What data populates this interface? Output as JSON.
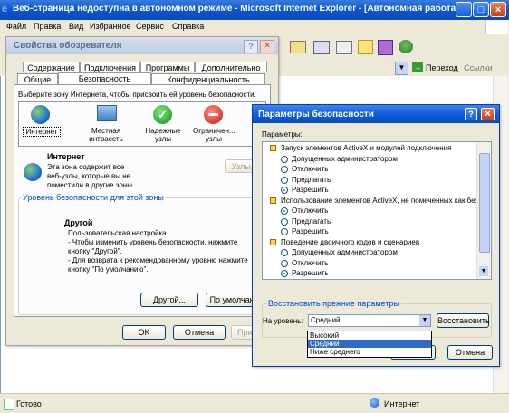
{
  "ie": {
    "title": "Веб-страница недоступна в автономном режиме - Microsoft Internet Explorer - [Автономная работа]",
    "menu": [
      "Файл",
      "Правка",
      "Вид",
      "Избранное",
      "Сервис",
      "Справка"
    ],
    "go_label": "Переход",
    "links_label": "Ссылки",
    "status_left": "Готово",
    "status_zone": "Интернет"
  },
  "props": {
    "title": "Свойства обозревателя",
    "tabs_row1": [
      "Содержание",
      "Подключения",
      "Программы",
      "Дополнительно"
    ],
    "tabs_row2": [
      "Общие",
      "Безопасность",
      "Конфиденциальность"
    ],
    "instruction": "Выберите зону Интернета, чтобы присвоить ей уровень безопасности.",
    "zones": [
      {
        "label": "Интернет"
      },
      {
        "label": "Местная интрасеть"
      },
      {
        "label": "Надежные узлы"
      },
      {
        "label": "Ограничен... узлы"
      }
    ],
    "zone_name": "Интернет",
    "zone_desc": "Эта зона содержит все веб-узлы, которые вы не поместили в другие зоны.",
    "sites_button": "Узлы...",
    "level_group": "Уровень безопасности для этой зоны",
    "level_title": "Другой",
    "level_text": "Пользовательская настройка.\n- Чтобы изменить уровень безопасности, нажмите кнопку \"Другой\".\n- Для возврата к рекомендованному уровню нажмите кнопку \"По умолчанию\".",
    "custom_button": "Другой...",
    "default_button": "По умолчанию",
    "ok_button": "OK",
    "cancel_button": "Отмена",
    "apply_button": "Приме"
  },
  "sec": {
    "title": "Параметры безопасности",
    "params_label": "Параметры:",
    "items": [
      {
        "kind": "header",
        "text": "Запуск элементов ActiveX и модулей подключения"
      },
      {
        "kind": "radio",
        "text": "Допущенных администратором",
        "checked": false
      },
      {
        "kind": "radio",
        "text": "Отключить",
        "checked": false
      },
      {
        "kind": "radio",
        "text": "Предлагать",
        "checked": false
      },
      {
        "kind": "radio",
        "text": "Разрешить",
        "checked": true
      },
      {
        "kind": "header",
        "text": "Использование элементов ActiveX, не помеченных как без"
      },
      {
        "kind": "radio",
        "text": "Отключить",
        "checked": true
      },
      {
        "kind": "radio",
        "text": "Предлагать",
        "checked": false
      },
      {
        "kind": "radio",
        "text": "Разрешить",
        "checked": false
      },
      {
        "kind": "header",
        "text": "Поведение двоичного кодов и сценариев"
      },
      {
        "kind": "radio",
        "text": "Допущенных администратором",
        "checked": false
      },
      {
        "kind": "radio",
        "text": "Отключить",
        "checked": false
      },
      {
        "kind": "radio",
        "text": "Разрешить",
        "checked": true
      }
    ],
    "restore_group": "Восстановить прежние параметры",
    "level_label": "На уровень:",
    "level_value": "Средний",
    "dropdown_options": [
      "Высокий",
      "Средний",
      "Ниже среднего"
    ],
    "dropdown_selected_index": 1,
    "restore_button": "Восстановить",
    "cancel_button": "Отмена"
  },
  "colors": {
    "accent": "#0a58d6",
    "selected": "#316ac5"
  }
}
